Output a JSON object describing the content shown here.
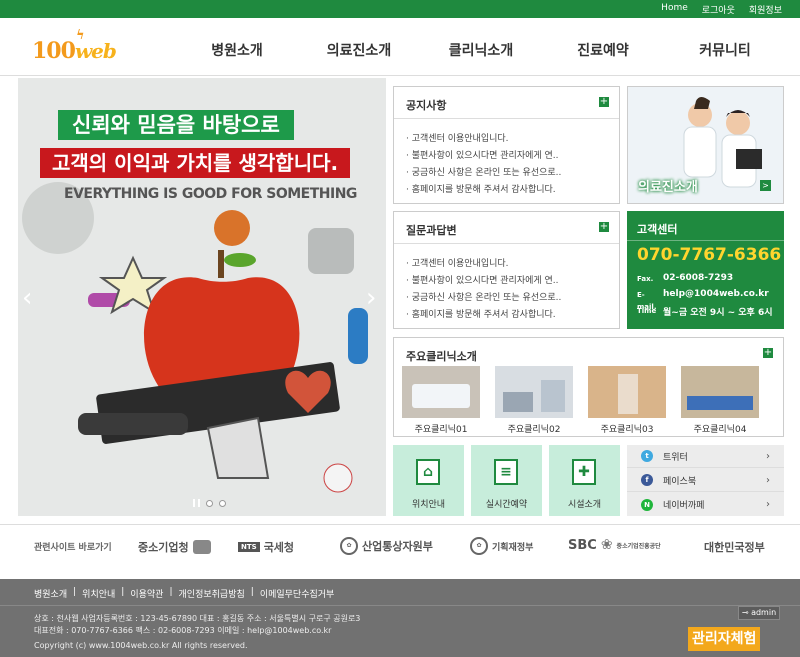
{
  "topbar": {
    "links": [
      "Home",
      "로그아웃",
      "회원정보"
    ]
  },
  "logo": {
    "main": "100",
    "web": "web"
  },
  "gnb": [
    "병원소개",
    "의료진소개",
    "클리닉소개",
    "진료예약",
    "커뮤니티"
  ],
  "hero": {
    "line1": "신뢰와 믿음을 바탕으로",
    "line2": "고객의 이익과 가치를 생각합니다.",
    "line3": "EVERYTHING IS GOOD FOR SOMETHING"
  },
  "notice": {
    "title": "공지사항",
    "items": [
      "고객센터 이용안내입니다.",
      "불편사항이 있으시다면 관리자에게 연..",
      "궁금하신 사항은 온라인 또는 유선으로..",
      "홈페이지를 방문해 주셔서 감사합니다."
    ]
  },
  "qna": {
    "title": "질문과답변",
    "items": [
      "고객센터 이용안내입니다.",
      "불편사항이 있으시다면 관리자에게 연..",
      "궁금하신 사항은 온라인 또는 유선으로..",
      "홈페이지를 방문해 주셔서 감사합니다."
    ]
  },
  "promo": {
    "label": "의료진소개",
    "go": ">"
  },
  "cs": {
    "title": "고객센터",
    "phone": "070-7767-6366",
    "fax_label": "Fax.",
    "fax": "02-6008-7293",
    "email_label": "E-mail.",
    "email": "help@1004web.co.kr",
    "time_label": "Time",
    "time": "월~금 오전 9시 ~ 오후 6시"
  },
  "clinic": {
    "title": "주요클리닉소개",
    "items": [
      "주요클리닉01",
      "주요클리닉02",
      "주요클리닉03",
      "주요클리닉04"
    ]
  },
  "quick": [
    {
      "label": "위치안내",
      "glyph": "⌂"
    },
    {
      "label": "실시간예약",
      "glyph": "≡"
    },
    {
      "label": "시설소개",
      "glyph": "✚"
    }
  ],
  "sns": [
    {
      "label": "트위터",
      "color": "#3fa9e0",
      "glyph": "t"
    },
    {
      "label": "페이스북",
      "color": "#3b5998",
      "glyph": "f"
    },
    {
      "label": "네이버까페",
      "color": "#1fb53b",
      "glyph": "N"
    }
  ],
  "family": {
    "title": "관련사이트 바로가기",
    "orgs": [
      "중소기업청",
      "국세청",
      "산업통상자원부",
      "기획재정부",
      "SBC",
      "중소기업진흥공단",
      "대한민국정부"
    ],
    "nts": "NTS"
  },
  "footer": {
    "links": [
      "병원소개",
      "|",
      "위치안내",
      "|",
      "이용약관",
      "|",
      "개인정보취급방침",
      "|",
      "이메일무단수집거부"
    ],
    "addr1": "상호 : 천사웹  사업자등록번호 : 123-45-67890  대표 : 홍길동  주소 : 서울특별시 구로구 공원로3",
    "addr2": "대표전화 : 070-7767-6366  팩스 : 02-6008-7293  이메일 : help@1004web.co.kr",
    "copy": "Copyright (c) www.1004web.co.kr All rights reserved.",
    "admin": "admin",
    "exp": "관리자체험"
  },
  "colors": {
    "brand_green": "#1f8a3f",
    "accent_red": "#c8181d",
    "accent_yellow": "#ffd52e",
    "logo_orange": "#f39a1c"
  }
}
